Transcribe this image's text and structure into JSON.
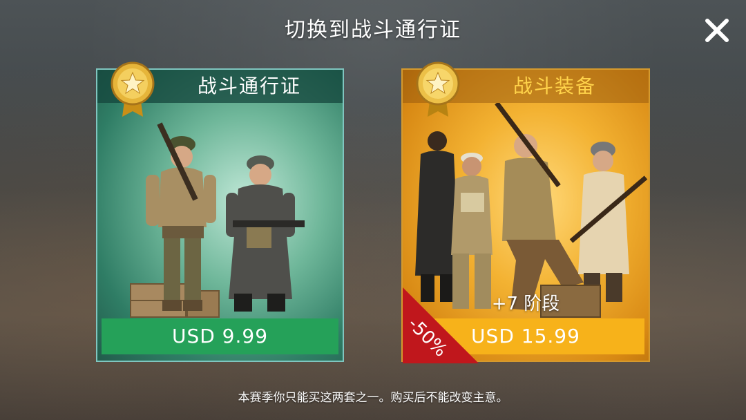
{
  "dialog": {
    "title": "切换到战斗通行证",
    "footnote": "本赛季你只能买这两套之一。购买后不能改变主意。"
  },
  "cards": [
    {
      "name": "战斗通行证",
      "price": "USD 9.99",
      "accent": "#25a159"
    },
    {
      "name": "战斗装备",
      "price": "USD 15.99",
      "tier_bonus": "+7 阶段",
      "discount": "-50%",
      "accent": "#f7b21a"
    }
  ],
  "icons": {
    "close": "close-icon",
    "medal": "star-medal-icon"
  }
}
